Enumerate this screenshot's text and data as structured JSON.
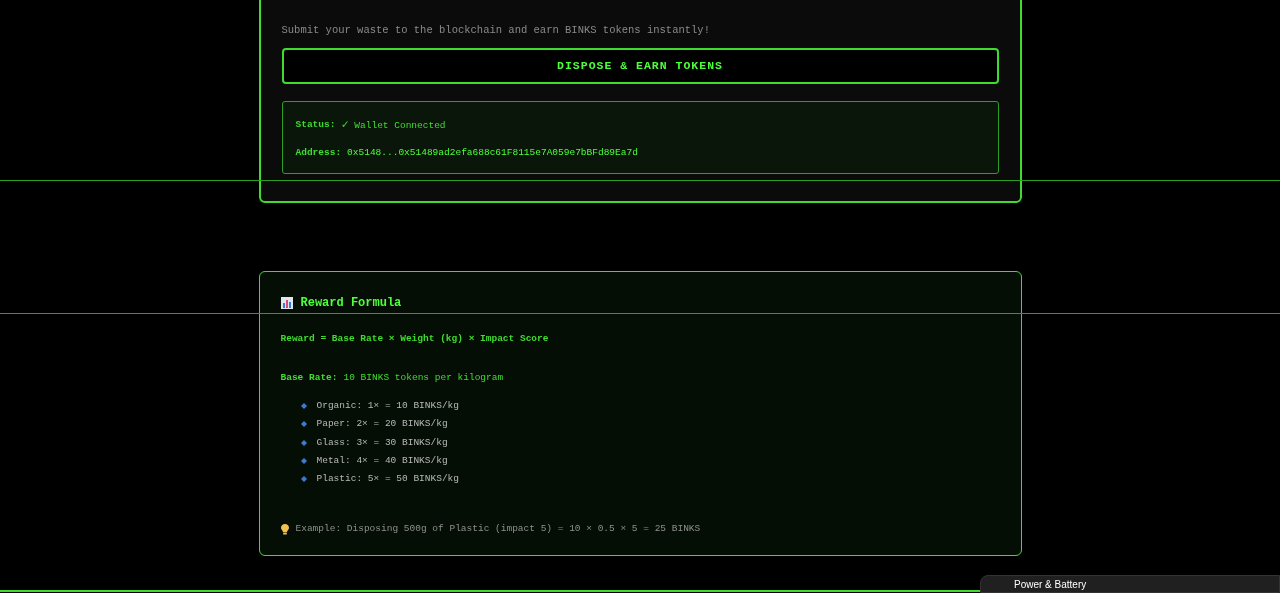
{
  "dispose_card": {
    "description": "Submit your waste to the blockchain and earn BINKS tokens instantly!",
    "button": "DISPOSE & EARN TOKENS",
    "status": {
      "label": "Status:",
      "check": "✓",
      "value": "Wallet Connected"
    },
    "address": {
      "label": "Address:",
      "value": "0x5148...0x51489ad2efa688c61F8115e7A059e7bBFd89Ea7d"
    }
  },
  "reward_card": {
    "title": "Reward Formula",
    "formula": "Reward = Base Rate × Weight (kg) × Impact Score",
    "base_rate": {
      "label": "Base Rate:",
      "value": "10 BINKS tokens per kilogram"
    },
    "rates": [
      "Organic: 1× = 10 BINKS/kg",
      "Paper: 2× = 20 BINKS/kg",
      "Glass: 3× = 30 BINKS/kg",
      "Metal: 4× = 40 BINKS/kg",
      "Plastic: 5× = 50 BINKS/kg"
    ],
    "example": "Example: Disposing 500g of Plastic (impact 5) = 10 × 0.5 × 5 = 25 BINKS"
  },
  "notification": {
    "title": "Power & Battery"
  }
}
